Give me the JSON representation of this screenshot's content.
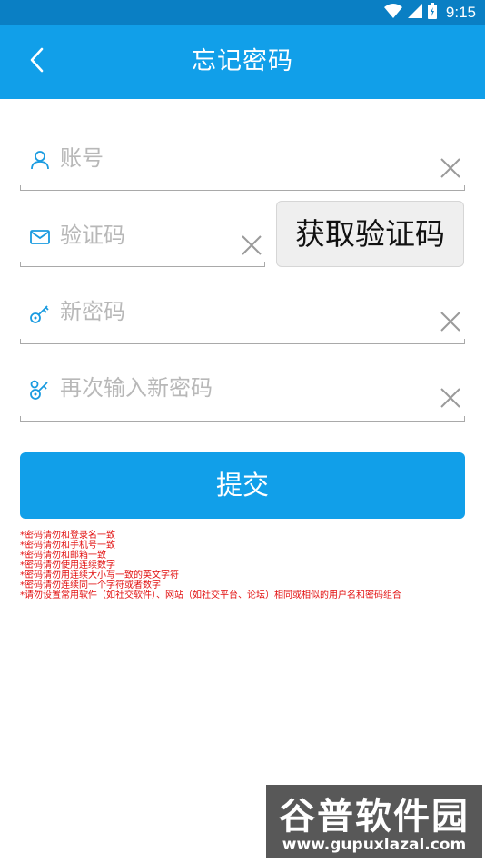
{
  "status_bar": {
    "time": "9:15",
    "icons": [
      "wifi-icon",
      "cell-signal-icon",
      "battery-icon"
    ],
    "background": "#0a7fc4"
  },
  "app_bar": {
    "title": "忘记密码",
    "back_icon": "chevron-left-icon",
    "background": "#119fe9"
  },
  "form": {
    "account": {
      "placeholder": "账号",
      "value": "",
      "icon": "user-icon"
    },
    "code": {
      "placeholder": "验证码",
      "value": "",
      "icon": "mail-icon"
    },
    "get_code_label": "获取验证码",
    "new_password": {
      "placeholder": "新密码",
      "value": "",
      "icon": "key-icon"
    },
    "confirm_password": {
      "placeholder": "再次输入新密码",
      "value": "",
      "icon": "key-double-icon"
    },
    "clear_icon": "close-icon",
    "submit_label": "提交"
  },
  "tips": [
    "*密码请勿和登录名一致",
    "*密码请勿和手机号一致",
    "*密码请勿和邮箱一致",
    "*密码请勿使用连续数字",
    "*密码请勿用连续大小写一致的英文字符",
    "*密码请勿连续同一个字符或者数字",
    "*请勿设置常用软件（如社交软件）、网站（如社交平台、论坛）相同或相似的用户名和密码组合"
  ],
  "watermark": {
    "brand": "谷普软件园",
    "url": "www.gupuxlazal.com"
  },
  "colors": {
    "accent": "#119fe9",
    "tip_red": "#e21010",
    "placeholder_gray": "#b8b8b8"
  }
}
